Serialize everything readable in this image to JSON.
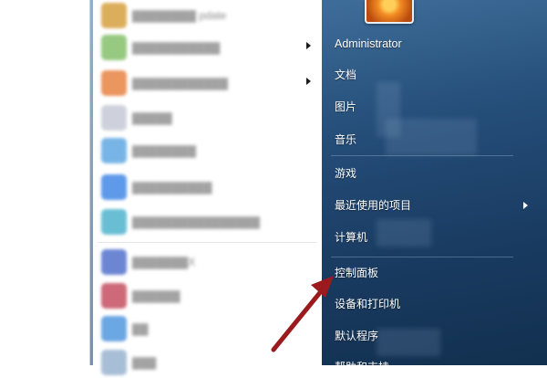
{
  "left_pane": {
    "items": [
      {
        "label": "▓▓▓▓▓▓▓▓ pdate",
        "icon": "blurred-app-icon",
        "color": "#d8a64a",
        "has_submenu": false
      },
      {
        "label": "▓▓▓▓▓▓▓▓▓▓▓",
        "icon": "blurred-app-icon",
        "color": "#8cc474",
        "has_submenu": true
      },
      {
        "label": "▓▓▓▓▓▓▓▓▓▓▓▓",
        "icon": "blurred-app-icon",
        "color": "#e98a4e",
        "has_submenu": true
      },
      {
        "label": "▓▓▓▓▓",
        "icon": "blurred-app-icon",
        "color": "#c9cdd8",
        "has_submenu": false
      },
      {
        "label": "▓▓▓▓▓▓▓▓",
        "icon": "blurred-app-icon",
        "color": "#6aaee4",
        "has_submenu": false
      },
      {
        "label": "▓▓▓▓▓▓▓▓▓▓",
        "icon": "blurred-app-icon",
        "color": "#4d8fe8",
        "has_submenu": false
      },
      {
        "label": "▓▓▓▓▓▓▓▓▓▓▓▓▓▓▓▓",
        "icon": "blurred-app-icon",
        "color": "#59b7d0",
        "has_submenu": false
      },
      {
        "label": "▓▓▓▓▓▓▓X",
        "icon": "blurred-app-icon",
        "color": "#5d7ad0",
        "has_submenu": false
      },
      {
        "label": "▓▓▓▓▓▓",
        "icon": "blurred-app-icon",
        "color": "#c8596b",
        "has_submenu": false
      },
      {
        "label": "▓▓",
        "icon": "blurred-app-icon",
        "color": "#5c9ee0",
        "has_submenu": false
      },
      {
        "label": "▓▓▓",
        "icon": "blurred-app-icon",
        "color": "#9fb8d2",
        "has_submenu": false
      }
    ]
  },
  "right_pane": {
    "user_name": "Administrator",
    "items": [
      {
        "label": "文档",
        "has_submenu": false
      },
      {
        "label": "图片",
        "has_submenu": false
      },
      {
        "label": "音乐",
        "has_submenu": false
      },
      {
        "label": "游戏",
        "has_submenu": false
      },
      {
        "label": "最近使用的项目",
        "has_submenu": true
      },
      {
        "label": "计算机",
        "has_submenu": false
      },
      {
        "label": "控制面板",
        "has_submenu": false
      },
      {
        "label": "设备和打印机",
        "has_submenu": false
      },
      {
        "label": "默认程序",
        "has_submenu": false
      },
      {
        "label": "帮助和支持",
        "has_submenu": false
      }
    ]
  },
  "colors": {
    "accent_arrow": "#9b1a1e",
    "right_pane_bg": "#244d78"
  },
  "annotation": {
    "icon": "red-arrow-icon",
    "points_to": "控制面板"
  }
}
